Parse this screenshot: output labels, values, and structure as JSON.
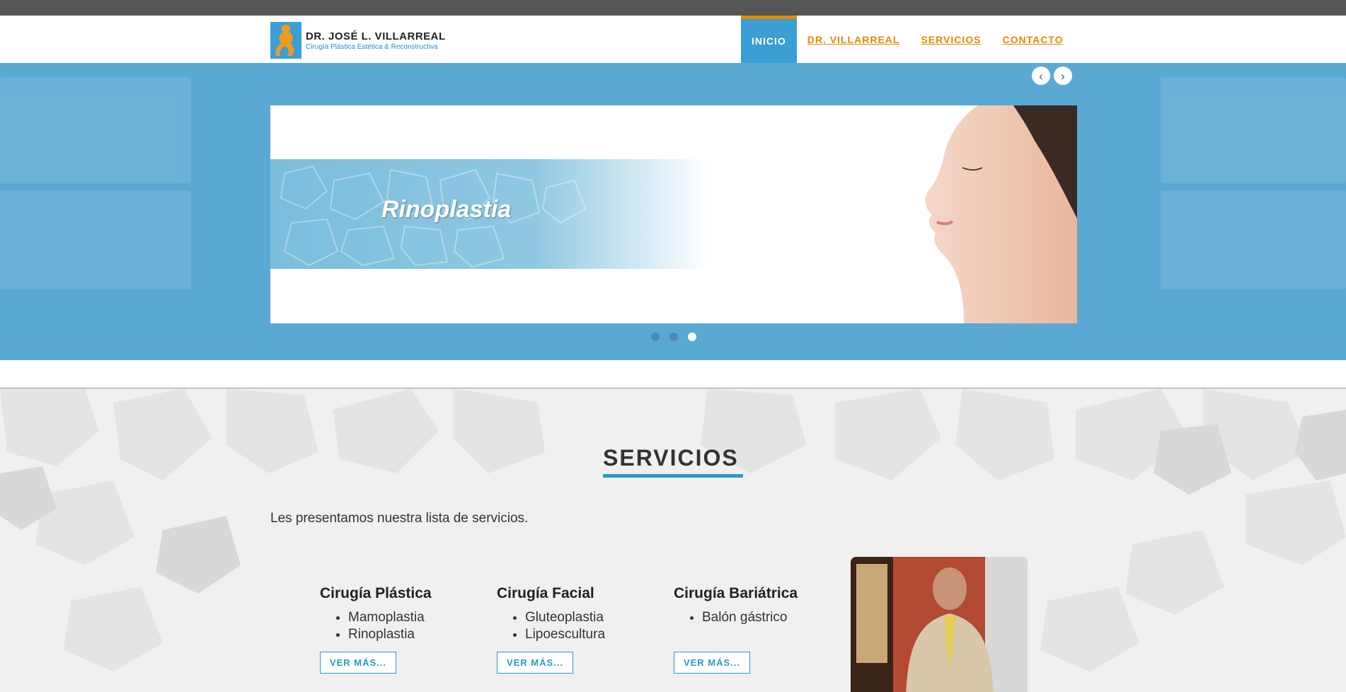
{
  "header": {
    "logo_name": "DR. JOSÉ L. VILLARREAL",
    "logo_subtitle": "Cirugía Plástica Estética & Reconstructiva",
    "nav": [
      {
        "label": "INICIO",
        "active": true
      },
      {
        "label": "DR. VILLARREAL",
        "active": false
      },
      {
        "label": "SERVICIOS",
        "active": false
      },
      {
        "label": "CONTACTO",
        "active": false
      }
    ]
  },
  "slider": {
    "prev_icon": "chevron-left-icon",
    "next_icon": "chevron-right-icon",
    "slide_title": "Rinoplastia",
    "dots": 3,
    "active_dot": 3
  },
  "services": {
    "title": "SERVICIOS",
    "intro": "Les presentamos nuestra lista de servicios.",
    "columns": [
      {
        "title": "Cirugía Plástica",
        "items": [
          "Mamoplastia",
          "Rinoplastia"
        ],
        "button": "VER MÁS..."
      },
      {
        "title": "Cirugía Facial",
        "items": [
          "Gluteoplastia",
          "Lipoescultura"
        ],
        "button": "VER MÁS..."
      },
      {
        "title": "Cirugía Bariátrica",
        "items": [
          "Balón gástrico"
        ],
        "button": "VER MÁS..."
      }
    ]
  },
  "colors": {
    "accent_blue": "#3b9ed4",
    "nav_orange": "#e68a00",
    "topbar": "#555555"
  }
}
